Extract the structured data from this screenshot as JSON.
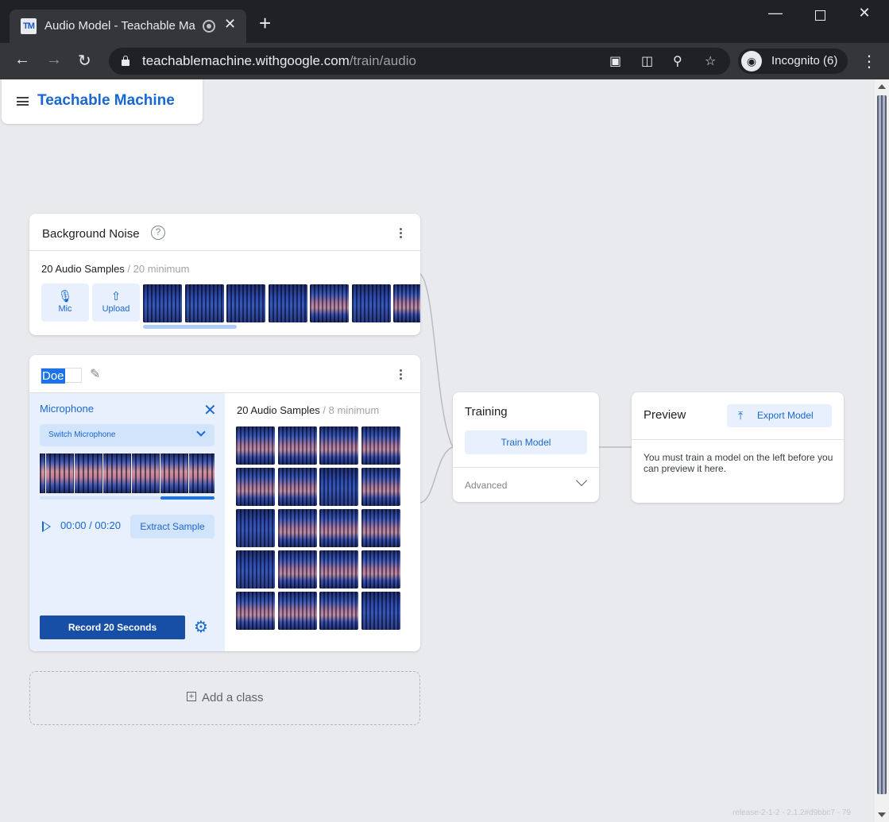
{
  "browser": {
    "tab_title": "Audio Model - Teachable Ma",
    "tab_favicon": "TM",
    "close_tab_glyph": "✕",
    "new_tab_glyph": "+",
    "url_host": "teachablemachine.withgoogle.com",
    "url_path": "/train/audio",
    "incognito_label": "Incognito (6)",
    "window_controls": {
      "minimize": "—",
      "close": "✕"
    },
    "icons": [
      "camera-icon",
      "translate-icon",
      "zoom-icon",
      "star-icon"
    ]
  },
  "app": {
    "brand": "Teachable Machine"
  },
  "background_class": {
    "title": "Background Noise",
    "help_glyph": "?",
    "samples_count": "20 Audio Samples",
    "samples_min": " / 20 minimum",
    "mic_label": "Mic",
    "upload_label": "Upload"
  },
  "custom_class": {
    "name": "Doe",
    "mic_panel": {
      "title": "Microphone",
      "switch_label": "Switch Microphone",
      "time_current": "00:00",
      "time_separator": " / ",
      "time_total": "00:20",
      "extract_label": "Extract Sample",
      "record_label": "Record 20 Seconds"
    },
    "samples_count": "20 Audio Samples",
    "samples_min": " / 8 minimum"
  },
  "add_class": {
    "label": "Add a class"
  },
  "training": {
    "title": "Training",
    "train_label": "Train Model",
    "advanced_label": "Advanced"
  },
  "preview": {
    "title": "Preview",
    "export_label": "Export Model",
    "message": "You must train a model on the left before you can preview it here."
  },
  "footer": {
    "version": "release-2-1-2 - 2.1.2#d9bbc7 - 79"
  },
  "colors": {
    "accent": "#1967d2",
    "record_button": "#174ea6",
    "page_background": "#e8eaed",
    "panel_tint": "#e8f0fe"
  }
}
